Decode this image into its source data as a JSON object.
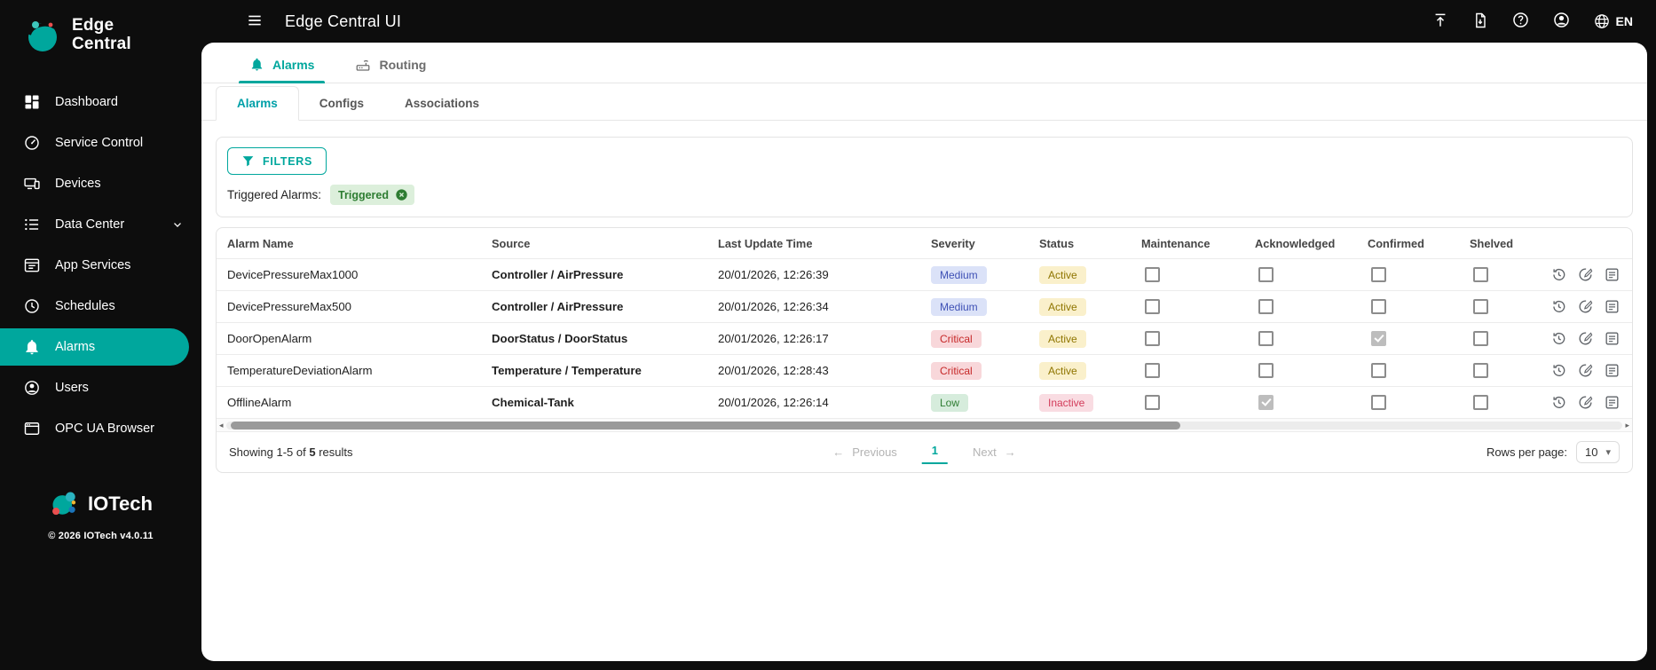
{
  "app": {
    "title": "Edge Central UI",
    "brand_line1": "Edge",
    "brand_line2": "Central",
    "language": "EN",
    "footer_brand": "IOTech",
    "copyright": "© 2026 IOTech v4.0.11"
  },
  "sidebar": {
    "items": [
      {
        "label": "Dashboard"
      },
      {
        "label": "Service Control"
      },
      {
        "label": "Devices"
      },
      {
        "label": "Data Center"
      },
      {
        "label": "App Services"
      },
      {
        "label": "Schedules"
      },
      {
        "label": "Alarms"
      },
      {
        "label": "Users"
      },
      {
        "label": "OPC UA Browser"
      }
    ],
    "active_item": "Alarms"
  },
  "tabs": {
    "primary": [
      {
        "label": "Alarms",
        "active": true
      },
      {
        "label": "Routing",
        "active": false
      }
    ],
    "secondary": [
      {
        "label": "Alarms",
        "active": true
      },
      {
        "label": "Configs",
        "active": false
      },
      {
        "label": "Associations",
        "active": false
      }
    ]
  },
  "filters": {
    "button_label": "FILTERS",
    "applied_label": "Triggered Alarms:",
    "chip_label": "Triggered"
  },
  "table": {
    "columns": [
      "Alarm Name",
      "Source",
      "Last Update Time",
      "Severity",
      "Status",
      "Maintenance",
      "Acknowledged",
      "Confirmed",
      "Shelved"
    ],
    "rows": [
      {
        "name": "DevicePressureMax1000",
        "device": "Controller",
        "separator": "/",
        "resource": "AirPressure",
        "time": "20/01/2026, 12:26:39",
        "severity": "Medium",
        "status": "Active",
        "maintenance": false,
        "acknowledged": false,
        "confirmed": false,
        "shelved": false
      },
      {
        "name": "DevicePressureMax500",
        "device": "Controller",
        "separator": "/",
        "resource": "AirPressure",
        "time": "20/01/2026, 12:26:34",
        "severity": "Medium",
        "status": "Active",
        "maintenance": false,
        "acknowledged": false,
        "confirmed": false,
        "shelved": false
      },
      {
        "name": "DoorOpenAlarm",
        "device": "DoorStatus",
        "separator": "/",
        "resource": "DoorStatus",
        "time": "20/01/2026, 12:26:17",
        "severity": "Critical",
        "status": "Active",
        "maintenance": false,
        "acknowledged": false,
        "confirmed": true,
        "shelved": false
      },
      {
        "name": "TemperatureDeviationAlarm",
        "device": "Temperature",
        "separator": "/",
        "resource": "Temperature",
        "time": "20/01/2026, 12:28:43",
        "severity": "Critical",
        "status": "Active",
        "maintenance": false,
        "acknowledged": false,
        "confirmed": false,
        "shelved": false
      },
      {
        "name": "OfflineAlarm",
        "device": "Chemical-Tank",
        "separator": "",
        "resource": "",
        "time": "20/01/2026, 12:26:14",
        "severity": "Low",
        "status": "Inactive",
        "maintenance": false,
        "acknowledged": true,
        "confirmed": false,
        "shelved": false
      }
    ]
  },
  "pagination": {
    "summary_prefix": "Showing 1-5 of",
    "summary_count": "5",
    "summary_suffix": "results",
    "previous_label": "Previous",
    "next_label": "Next",
    "current_page": "1",
    "rows_per_page_label": "Rows per page:",
    "rows_per_page_value": "10"
  },
  "icons": {
    "arrow-left": "←",
    "arrow-right": "→",
    "dropdown-chevron": "▾",
    "scroll-left": "◂",
    "scroll-right": "▸"
  },
  "colors": {
    "accent_teal": "#00a79d",
    "sidebar_bg": "#0d0d0d",
    "severity_medium_bg": "#dbe2f8",
    "severity_medium_text": "#3f51b5",
    "severity_critical_bg": "#f8d7da",
    "severity_critical_text": "#c62828",
    "severity_low_bg": "#d6ecdc",
    "severity_low_text": "#2e7d32",
    "status_active_bg": "#faf0cb",
    "status_active_text": "#8f7500",
    "status_inactive_bg": "#f9dce2",
    "status_inactive_text": "#d23b5a",
    "filter_chip_bg": "#dcefdb",
    "filter_chip_text": "#2e7d32"
  }
}
